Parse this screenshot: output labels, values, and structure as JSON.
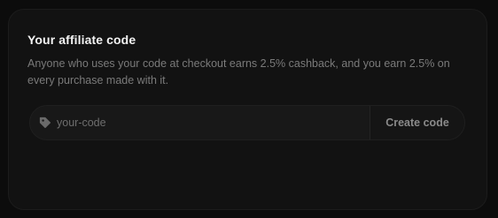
{
  "affiliate": {
    "title": "Your affiliate code",
    "description": "Anyone who uses your code at checkout earns 2.5% cashback, and you earn 2.5% on every purchase made with it.",
    "input": {
      "value": "",
      "placeholder": "your-code",
      "icon": "tag-icon"
    },
    "create_button_label": "Create code"
  },
  "colors": {
    "background": "#0c0c0c",
    "card": "#121212",
    "title_text": "#f2f2f2",
    "muted_text": "#7a7a7a"
  }
}
